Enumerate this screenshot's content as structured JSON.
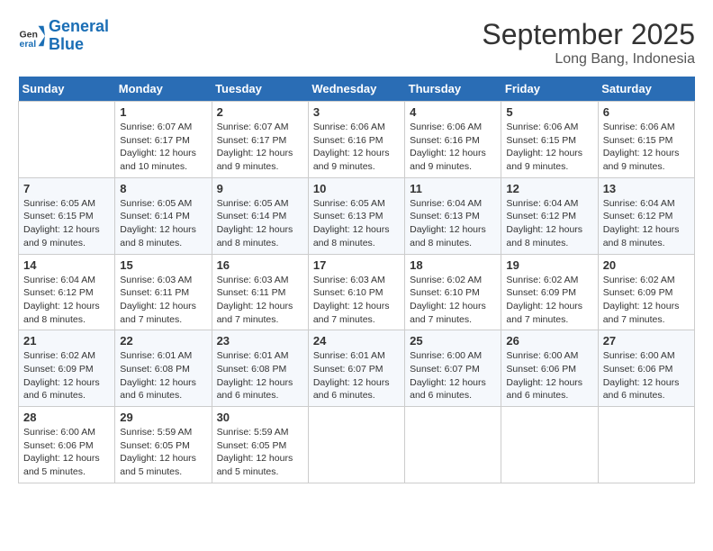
{
  "header": {
    "logo_line1": "General",
    "logo_line2": "Blue",
    "month": "September 2025",
    "location": "Long Bang, Indonesia"
  },
  "weekdays": [
    "Sunday",
    "Monday",
    "Tuesday",
    "Wednesday",
    "Thursday",
    "Friday",
    "Saturday"
  ],
  "weeks": [
    [
      {
        "day": "",
        "info": ""
      },
      {
        "day": "1",
        "info": "Sunrise: 6:07 AM\nSunset: 6:17 PM\nDaylight: 12 hours\nand 10 minutes."
      },
      {
        "day": "2",
        "info": "Sunrise: 6:07 AM\nSunset: 6:17 PM\nDaylight: 12 hours\nand 9 minutes."
      },
      {
        "day": "3",
        "info": "Sunrise: 6:06 AM\nSunset: 6:16 PM\nDaylight: 12 hours\nand 9 minutes."
      },
      {
        "day": "4",
        "info": "Sunrise: 6:06 AM\nSunset: 6:16 PM\nDaylight: 12 hours\nand 9 minutes."
      },
      {
        "day": "5",
        "info": "Sunrise: 6:06 AM\nSunset: 6:15 PM\nDaylight: 12 hours\nand 9 minutes."
      },
      {
        "day": "6",
        "info": "Sunrise: 6:06 AM\nSunset: 6:15 PM\nDaylight: 12 hours\nand 9 minutes."
      }
    ],
    [
      {
        "day": "7",
        "info": "Sunrise: 6:05 AM\nSunset: 6:15 PM\nDaylight: 12 hours\nand 9 minutes."
      },
      {
        "day": "8",
        "info": "Sunrise: 6:05 AM\nSunset: 6:14 PM\nDaylight: 12 hours\nand 8 minutes."
      },
      {
        "day": "9",
        "info": "Sunrise: 6:05 AM\nSunset: 6:14 PM\nDaylight: 12 hours\nand 8 minutes."
      },
      {
        "day": "10",
        "info": "Sunrise: 6:05 AM\nSunset: 6:13 PM\nDaylight: 12 hours\nand 8 minutes."
      },
      {
        "day": "11",
        "info": "Sunrise: 6:04 AM\nSunset: 6:13 PM\nDaylight: 12 hours\nand 8 minutes."
      },
      {
        "day": "12",
        "info": "Sunrise: 6:04 AM\nSunset: 6:12 PM\nDaylight: 12 hours\nand 8 minutes."
      },
      {
        "day": "13",
        "info": "Sunrise: 6:04 AM\nSunset: 6:12 PM\nDaylight: 12 hours\nand 8 minutes."
      }
    ],
    [
      {
        "day": "14",
        "info": "Sunrise: 6:04 AM\nSunset: 6:12 PM\nDaylight: 12 hours\nand 8 minutes."
      },
      {
        "day": "15",
        "info": "Sunrise: 6:03 AM\nSunset: 6:11 PM\nDaylight: 12 hours\nand 7 minutes."
      },
      {
        "day": "16",
        "info": "Sunrise: 6:03 AM\nSunset: 6:11 PM\nDaylight: 12 hours\nand 7 minutes."
      },
      {
        "day": "17",
        "info": "Sunrise: 6:03 AM\nSunset: 6:10 PM\nDaylight: 12 hours\nand 7 minutes."
      },
      {
        "day": "18",
        "info": "Sunrise: 6:02 AM\nSunset: 6:10 PM\nDaylight: 12 hours\nand 7 minutes."
      },
      {
        "day": "19",
        "info": "Sunrise: 6:02 AM\nSunset: 6:09 PM\nDaylight: 12 hours\nand 7 minutes."
      },
      {
        "day": "20",
        "info": "Sunrise: 6:02 AM\nSunset: 6:09 PM\nDaylight: 12 hours\nand 7 minutes."
      }
    ],
    [
      {
        "day": "21",
        "info": "Sunrise: 6:02 AM\nSunset: 6:09 PM\nDaylight: 12 hours\nand 6 minutes."
      },
      {
        "day": "22",
        "info": "Sunrise: 6:01 AM\nSunset: 6:08 PM\nDaylight: 12 hours\nand 6 minutes."
      },
      {
        "day": "23",
        "info": "Sunrise: 6:01 AM\nSunset: 6:08 PM\nDaylight: 12 hours\nand 6 minutes."
      },
      {
        "day": "24",
        "info": "Sunrise: 6:01 AM\nSunset: 6:07 PM\nDaylight: 12 hours\nand 6 minutes."
      },
      {
        "day": "25",
        "info": "Sunrise: 6:00 AM\nSunset: 6:07 PM\nDaylight: 12 hours\nand 6 minutes."
      },
      {
        "day": "26",
        "info": "Sunrise: 6:00 AM\nSunset: 6:06 PM\nDaylight: 12 hours\nand 6 minutes."
      },
      {
        "day": "27",
        "info": "Sunrise: 6:00 AM\nSunset: 6:06 PM\nDaylight: 12 hours\nand 6 minutes."
      }
    ],
    [
      {
        "day": "28",
        "info": "Sunrise: 6:00 AM\nSunset: 6:06 PM\nDaylight: 12 hours\nand 5 minutes."
      },
      {
        "day": "29",
        "info": "Sunrise: 5:59 AM\nSunset: 6:05 PM\nDaylight: 12 hours\nand 5 minutes."
      },
      {
        "day": "30",
        "info": "Sunrise: 5:59 AM\nSunset: 6:05 PM\nDaylight: 12 hours\nand 5 minutes."
      },
      {
        "day": "",
        "info": ""
      },
      {
        "day": "",
        "info": ""
      },
      {
        "day": "",
        "info": ""
      },
      {
        "day": "",
        "info": ""
      }
    ]
  ]
}
